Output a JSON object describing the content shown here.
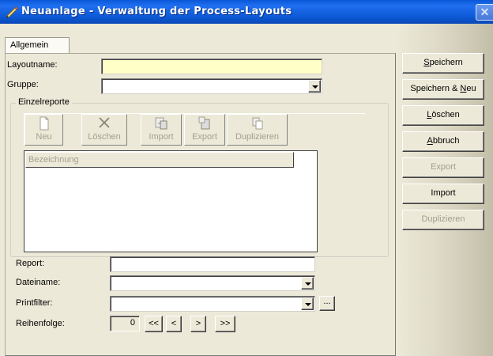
{
  "window": {
    "title": "Neuanlage - Verwaltung der Process-Layouts",
    "title_icon": "pencil-icon",
    "close_label": "✕"
  },
  "tabs": [
    {
      "label": "Allgemein",
      "active": true
    }
  ],
  "form": {
    "layoutname_label": "Layoutname:",
    "layoutname_value": "",
    "gruppe_label": "Gruppe:",
    "gruppe_value": ""
  },
  "einzelreporte": {
    "legend": "Einzelreporte",
    "toolbar": [
      {
        "label": "Neu",
        "icon": "new-document-icon",
        "enabled": false
      },
      {
        "label": "Löschen",
        "icon": "delete-x-icon",
        "enabled": false
      },
      {
        "label": "Import",
        "icon": "import-icon",
        "enabled": false
      },
      {
        "label": "Export",
        "icon": "export-icon",
        "enabled": false
      },
      {
        "label": "Duplizieren",
        "icon": "duplicate-icon",
        "enabled": false
      }
    ],
    "list_column": "Bezeichnung"
  },
  "details": {
    "report_label": "Report:",
    "report_value": "",
    "dateiname_label": "Dateiname:",
    "dateiname_value": "",
    "printfilter_label": "Printfilter:",
    "printfilter_value": "",
    "browse_label": "...",
    "reihenfolge_label": "Reihenfolge:",
    "reihenfolge_value": "0",
    "nav": {
      "first": "<<",
      "prev": "<",
      "next": ">",
      "last": ">>"
    }
  },
  "actions": {
    "speichern": {
      "pre": "",
      "ul": "S",
      "post": "peichern",
      "enabled": true
    },
    "speichern_neu": {
      "pre": "Speichern & ",
      "ul": "N",
      "post": "eu",
      "enabled": true
    },
    "loeschen": {
      "pre": "",
      "ul": "L",
      "post": "öschen",
      "enabled": true
    },
    "abbruch": {
      "pre": "",
      "ul": "A",
      "post": "bbruch",
      "enabled": true
    },
    "export": {
      "label": "Export",
      "enabled": false
    },
    "import": {
      "label": "Import",
      "enabled": true
    },
    "duplizieren": {
      "label": "Duplizieren",
      "enabled": false
    }
  }
}
